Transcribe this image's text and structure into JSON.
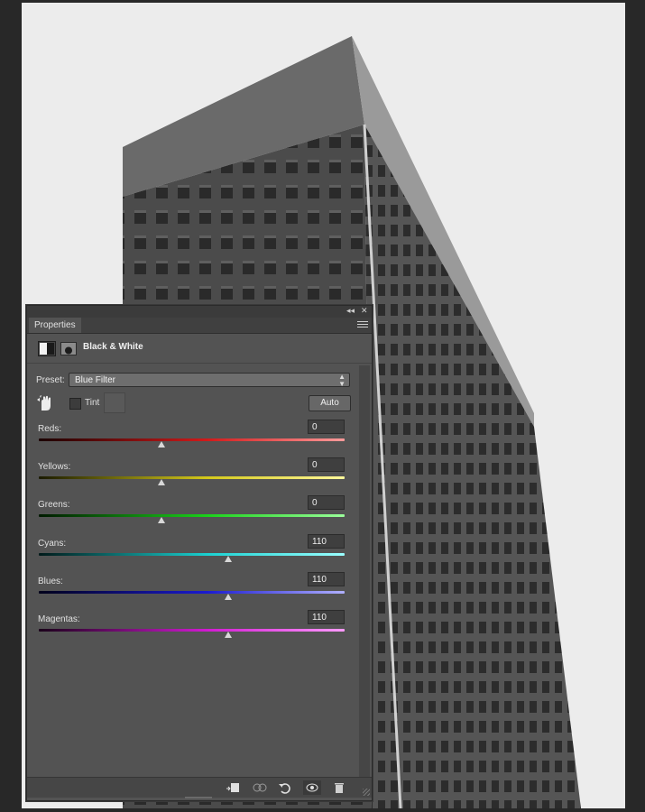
{
  "panel": {
    "tab_label": "Properties",
    "collapse_glyph": "◂◂",
    "close_glyph": "✕",
    "title": "Black & White",
    "preset_label": "Preset:",
    "preset_value": "Blue Filter",
    "tint_label": "Tint",
    "tint_checked": false,
    "auto_label": "Auto",
    "sliders": [
      {
        "label": "Reds:",
        "value": "0",
        "colors": [
          "#1a0000",
          "#d11a1a",
          "#ff9b9b"
        ]
      },
      {
        "label": "Yellows:",
        "value": "0",
        "colors": [
          "#1a1a00",
          "#d4c81a",
          "#fff89b"
        ]
      },
      {
        "label": "Greens:",
        "value": "0",
        "colors": [
          "#001a00",
          "#1ad11a",
          "#9bff9b"
        ]
      },
      {
        "label": "Cyans:",
        "value": "110",
        "colors": [
          "#001a1a",
          "#1ad1d1",
          "#9bffff"
        ]
      },
      {
        "label": "Blues:",
        "value": "110",
        "colors": [
          "#00001a",
          "#1a1ad1",
          "#b0b0ff"
        ]
      },
      {
        "label": "Magentas:",
        "value": "110",
        "colors": [
          "#1a001a",
          "#d11ad1",
          "#ff9bff"
        ]
      }
    ],
    "slider_min": -200,
    "slider_max": 300,
    "footer_icons": [
      "clip-to-layer-icon",
      "view-previous-icon",
      "reset-icon",
      "visibility-eye-icon",
      "trash-icon"
    ]
  },
  "colors": {
    "panel_bg": "#535353",
    "canvas_bg": "#ececec",
    "app_bg": "#282828"
  }
}
